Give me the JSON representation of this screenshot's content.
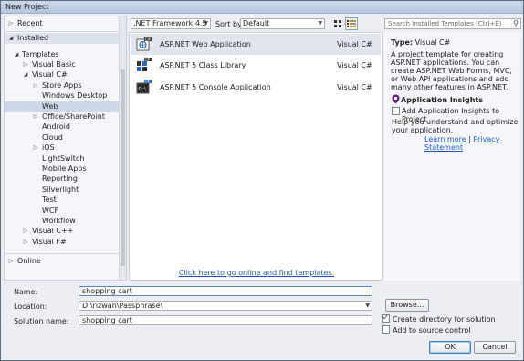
{
  "window": {
    "title": "New Project"
  },
  "nav": {
    "recent": "Recent",
    "installed": "Installed",
    "templates": "Templates",
    "tree": [
      {
        "label": "Visual Basic",
        "expander": "right"
      },
      {
        "label": "Visual C#",
        "expander": "down"
      },
      {
        "label": "Store Apps",
        "expander": "right"
      },
      {
        "label": "Windows Desktop",
        "expander": ""
      },
      {
        "label": "Web",
        "expander": "",
        "selected": true
      },
      {
        "label": "Office/SharePoint",
        "expander": "right"
      },
      {
        "label": "Android",
        "expander": ""
      },
      {
        "label": "Cloud",
        "expander": ""
      },
      {
        "label": "iOS",
        "expander": "right"
      },
      {
        "label": "LightSwitch",
        "expander": ""
      },
      {
        "label": "Mobile Apps",
        "expander": ""
      },
      {
        "label": "Reporting",
        "expander": ""
      },
      {
        "label": "Silverlight",
        "expander": ""
      },
      {
        "label": "Test",
        "expander": ""
      },
      {
        "label": "WCF",
        "expander": ""
      },
      {
        "label": "Workflow",
        "expander": ""
      },
      {
        "label": "Visual C++",
        "expander": "right"
      },
      {
        "label": "Visual F#",
        "expander": "right"
      }
    ],
    "online": "Online"
  },
  "toolbar": {
    "framework": ".NET Framework 4.5",
    "sort_label": "Sort by:",
    "sort_value": "Default",
    "search_placeholder": "Search Installed Templates (Ctrl+E)"
  },
  "templates": [
    {
      "name": "ASP.NET Web Application",
      "lang": "Visual C#",
      "icon": "web-app-icon",
      "selected": true
    },
    {
      "name": "ASP.NET 5 Class Library",
      "lang": "Visual C#",
      "icon": "class-library-icon"
    },
    {
      "name": "ASP.NET 5 Console Application",
      "lang": "Visual C#",
      "icon": "console-app-icon"
    }
  ],
  "online_link": "Click here to go online and find templates.",
  "info": {
    "type_label": "Type:",
    "type_value": "Visual C#",
    "description": "A project template for creating ASP.NET applications. You can create ASP.NET Web Forms, MVC,  or Web API applications and add many other features in ASP.NET.",
    "ai_title": "Application Insights",
    "ai_add": "Add Application Insights to Project",
    "ai_help": "Help you understand and optimize your application.",
    "learn_more": "Learn more",
    "link_sep": " | ",
    "privacy": "Privacy Statement"
  },
  "form": {
    "name_label": "Name:",
    "name_value": "shopping cart",
    "location_label": "Location:",
    "location_value": "D:\\rizwan\\Passphrase\\",
    "solution_label": "Solution name:",
    "solution_value": "shopping cart",
    "browse": "Browse...",
    "create_dir": "Create directory for solution",
    "create_dir_checked": true,
    "source_control": "Add to source control",
    "source_control_checked": false,
    "ok": "OK",
    "cancel": "Cancel"
  },
  "colors": {
    "accent": "#3c7fb1",
    "link": "#1e5bbd",
    "selection": "#ccd8ea"
  }
}
